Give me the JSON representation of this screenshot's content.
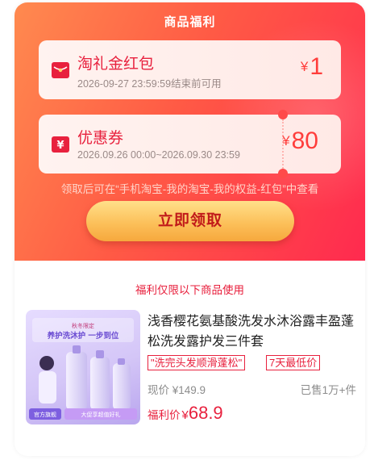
{
  "header": {
    "title": "商品福利"
  },
  "coupons": [
    {
      "icon": "red-envelope-icon",
      "name": "淘礼金红包",
      "validity": "2026-09-27 23:59:59结束前可用",
      "currency": "¥",
      "amount": "1"
    },
    {
      "icon": "ticket-icon",
      "name": "优惠券",
      "validity": "2026.09.26 00:00~2026.09.30 23:59",
      "currency": "¥",
      "amount": "80"
    }
  ],
  "hint": "领取后可在“手机淘宝-我的淘宝-我的权益-红包”中查看",
  "claim_button": {
    "label": "立即领取"
  },
  "section": {
    "title": "福利仅限以下商品使用"
  },
  "product": {
    "title": "浅香樱花氨基酸洗发水沐浴露丰盈蓬松洗发露护发三件套",
    "tags": [
      "\"洗完头发顺滑蓬松\"",
      "7天最低价"
    ],
    "current_price_label": "现价",
    "current_price": "¥149.9",
    "sold": "已售1万+件",
    "benefit_label": "福利价",
    "benefit_currency": "¥",
    "benefit_price": "68.9",
    "thumbnail_text": {
      "brand_line": "秋冬限定",
      "headline": "养护洗沐护 一步到位",
      "left_badge": "官方旗舰",
      "right_badge": "大促享超值好礼"
    }
  },
  "colors": {
    "accent": "#e8213e",
    "hero_start": "#ff8a4f",
    "hero_end": "#ff2a4f",
    "button": "#fcc05a"
  }
}
